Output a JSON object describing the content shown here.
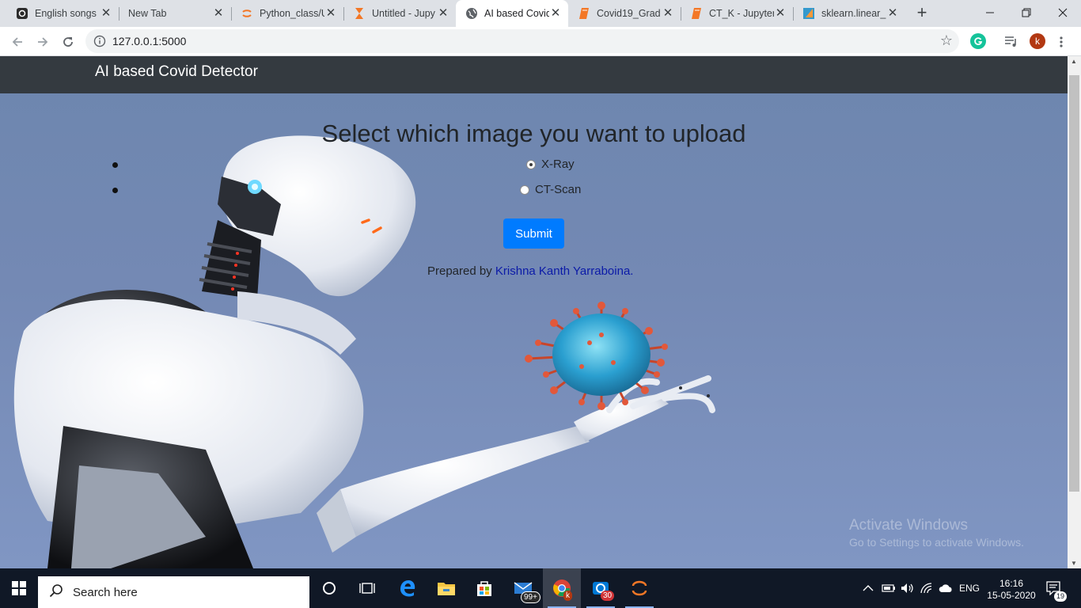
{
  "browser": {
    "tabs": [
      {
        "title": "English songs",
        "icon": "music-icon",
        "active": false
      },
      {
        "title": "New Tab",
        "icon": "",
        "active": false
      },
      {
        "title": "Python_class/U",
        "icon": "jupyter-icon",
        "active": false
      },
      {
        "title": "Untitled - Jupy",
        "icon": "hourglass-icon",
        "active": false
      },
      {
        "title": "AI based Covid",
        "icon": "globe-icon",
        "active": true
      },
      {
        "title": "Covid19_Grad",
        "icon": "notebook-icon",
        "active": false
      },
      {
        "title": "CT_K - Jupyter",
        "icon": "notebook-icon",
        "active": false
      },
      {
        "title": "sklearn.linear_",
        "icon": "sklearn-icon",
        "active": false
      }
    ],
    "url": "127.0.0.1:5000",
    "profile_initial": "k"
  },
  "page": {
    "brand": "AI based Covid Detector",
    "headline": "Select which image you want to upload",
    "options": [
      {
        "label": "X-Ray",
        "checked": true
      },
      {
        "label": "CT-Scan",
        "checked": false
      }
    ],
    "submit_label": "Submit",
    "prepared_prefix": "Prepared by ",
    "author": "Krishna Kanth Yarraboina",
    "prepared_suffix": "."
  },
  "watermark": {
    "title": "Activate Windows",
    "subtitle": "Go to Settings to activate Windows."
  },
  "taskbar": {
    "search_placeholder": "Search here",
    "mail_badge": "99+",
    "chrome_badge": "k",
    "skype_badge": "30",
    "language": "ENG",
    "time": "16:16",
    "date": "15-05-2020",
    "notifications": "19"
  },
  "colors": {
    "navbar": "#343a40",
    "submit": "#007bff",
    "author_link": "#0b1aa8",
    "page_bg": "#7489b4"
  }
}
